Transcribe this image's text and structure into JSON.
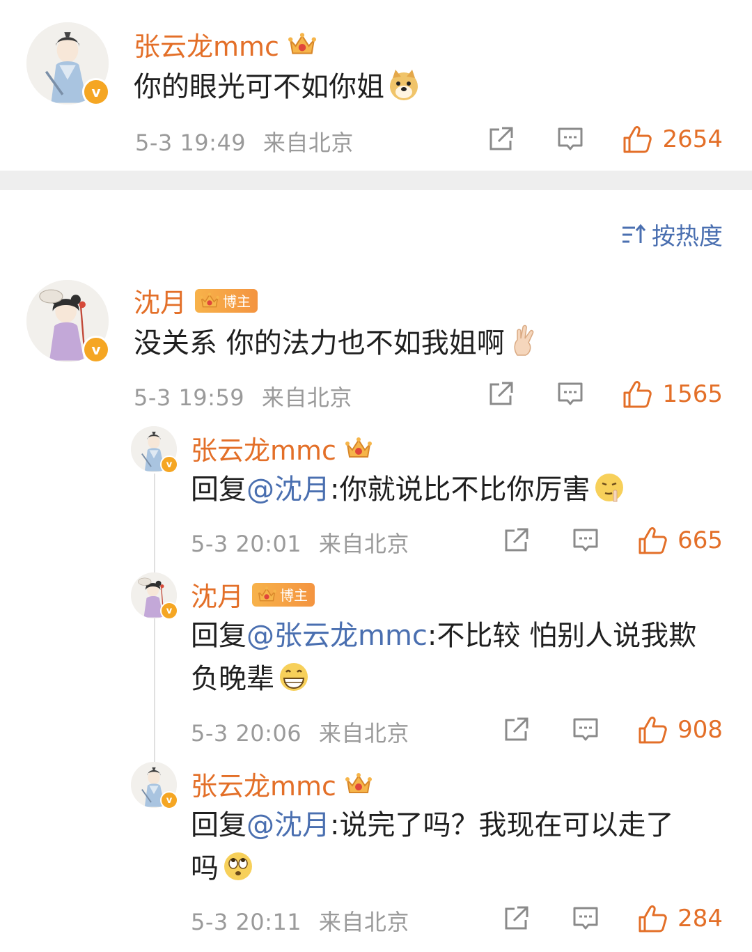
{
  "top_comment": {
    "username": "张云龙mmc",
    "text": "你的眼光可不如你姐",
    "emoji": "doge-emoji",
    "time": "5-3 19:49",
    "location": "来自北京",
    "likes": "2654"
  },
  "sort": {
    "label": "按热度",
    "icon": "sort-icon"
  },
  "main_comment": {
    "username": "沈月",
    "badge_label": "博主",
    "text": "没关系 你的法力也不如我姐啊",
    "emoji": "ok-hand-emoji",
    "time": "5-3 19:59",
    "location": "来自北京",
    "likes": "1565"
  },
  "replies": [
    {
      "username": "张云龙mmc",
      "reply_prefix": "回复",
      "mention": "@沈月",
      "text": ":你就说比不比你厉害",
      "emoji": "shush-emoji",
      "time": "5-3 20:01",
      "location": "来自北京",
      "likes": "665"
    },
    {
      "username": "沈月",
      "badge_label": "博主",
      "reply_prefix": "回复",
      "mention": "@张云龙mmc",
      "text_line1": ":不比较 怕别人说我欺",
      "text_line2": "负晚辈",
      "emoji": "grin-emoji",
      "time": "5-3 20:06",
      "location": "来自北京",
      "likes": "908"
    },
    {
      "username": "张云龙mmc",
      "reply_prefix": "回复",
      "mention": "@沈月",
      "text_line1": ":说完了吗？我现在可以走了",
      "text_line2": "吗",
      "emoji": "eye-roll-emoji",
      "time": "5-3 20:11",
      "location": "来自北京",
      "likes": "284"
    }
  ],
  "colors": {
    "accent": "#e36f28",
    "link": "#4a6fb0",
    "meta": "#9a9a9a",
    "divider": "#eeeeee",
    "badge": "#f5a623"
  }
}
